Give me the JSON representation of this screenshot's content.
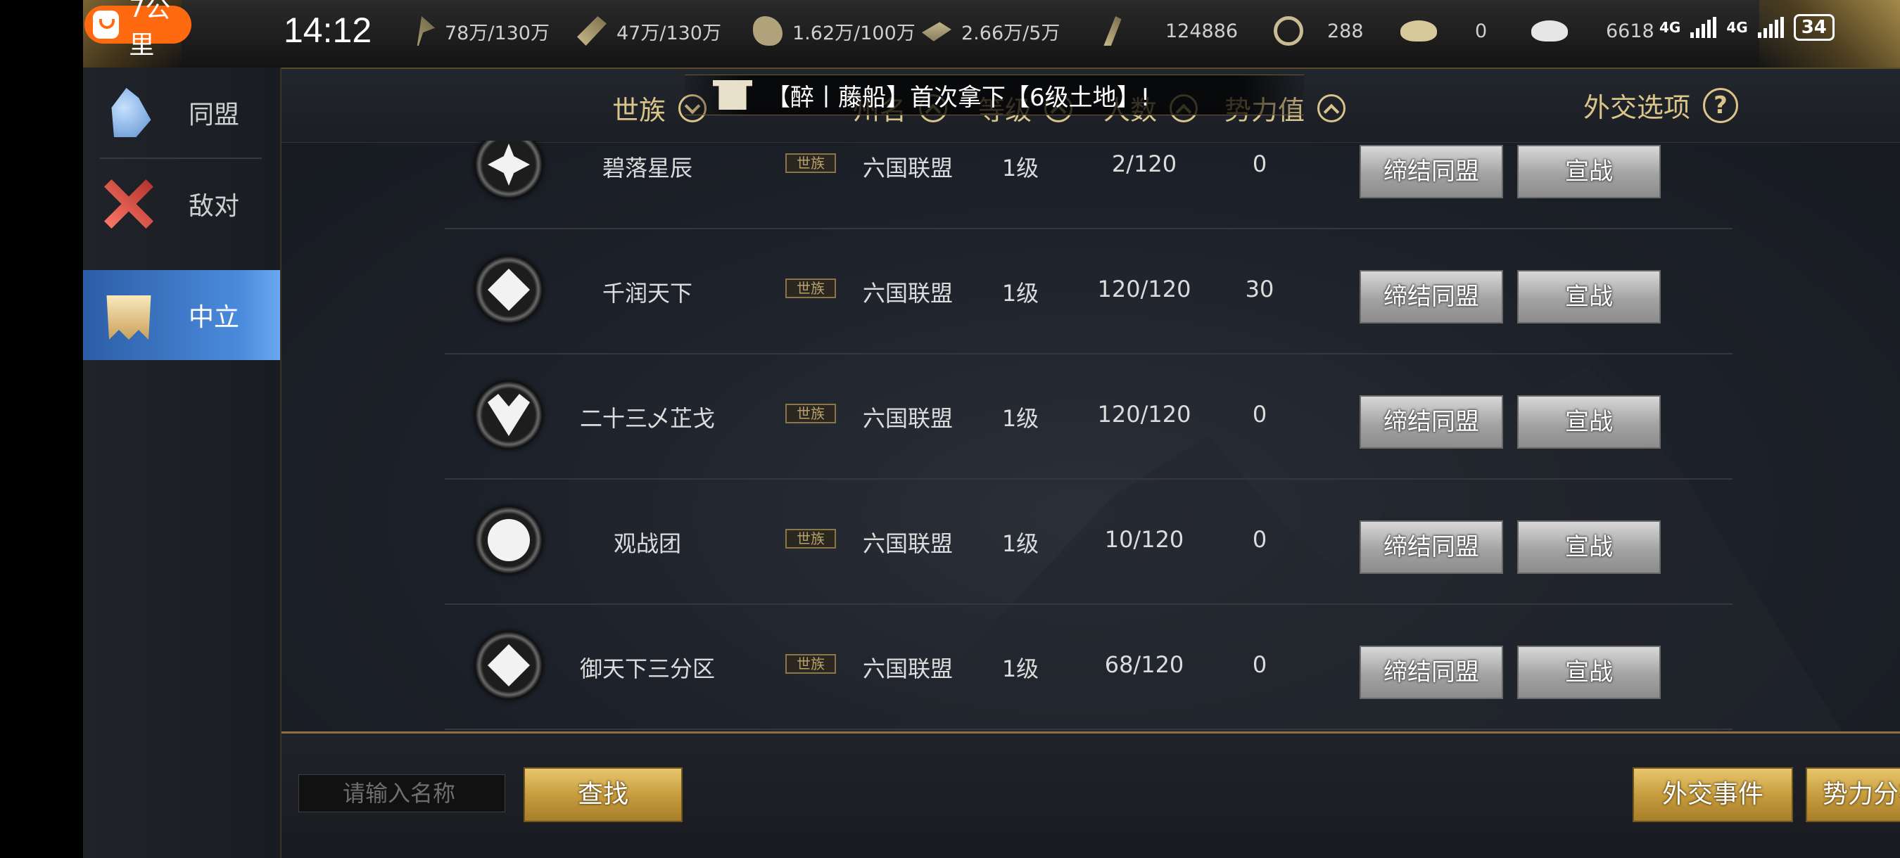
{
  "status": {
    "ride_label": "7公里",
    "clock": "14:12",
    "net1": "4G",
    "net2": "4G",
    "battery": "34"
  },
  "resources": [
    {
      "icon": "grain-icon",
      "value": "78万/130万"
    },
    {
      "icon": "wood-icon",
      "value": "47万/130万"
    },
    {
      "icon": "stone-icon",
      "value": "1.62万/100万"
    },
    {
      "icon": "iron-icon",
      "value": "2.66万/5万"
    },
    {
      "icon": "order-icon",
      "value": "124886"
    },
    {
      "icon": "coin-icon",
      "value": "288"
    },
    {
      "icon": "gold-ingot-icon",
      "value": "0"
    },
    {
      "icon": "silver-ingot-icon",
      "value": "6618"
    }
  ],
  "sidebar": {
    "items": [
      {
        "label": "同盟",
        "icon": "alliance-icon"
      },
      {
        "label": "敌对",
        "icon": "crossed-swords-icon"
      },
      {
        "label": "中立",
        "icon": "banner-icon"
      }
    ],
    "active_index": 2
  },
  "header": {
    "col_clan": "世族",
    "col_state": "州名",
    "col_level": "等级",
    "col_members": "人数",
    "col_power": "势力值",
    "col_diplomacy": "外交选项",
    "help": "?"
  },
  "banner": {
    "text": "【醉丨藤船】首次拿下【6级土地】!"
  },
  "rows": [
    {
      "name": "碧落星辰",
      "tag": "世族",
      "state": "六国联盟",
      "level": "1级",
      "members": "2/120",
      "power": "0",
      "btn_ally": "缔结同盟",
      "btn_war": "宣战"
    },
    {
      "name": "千润天下",
      "tag": "世族",
      "state": "六国联盟",
      "level": "1级",
      "members": "120/120",
      "power": "30",
      "btn_ally": "缔结同盟",
      "btn_war": "宣战"
    },
    {
      "name": "二十三乄芷戈",
      "tag": "世族",
      "state": "六国联盟",
      "level": "1级",
      "members": "120/120",
      "power": "0",
      "btn_ally": "缔结同盟",
      "btn_war": "宣战"
    },
    {
      "name": "观战团",
      "tag": "世族",
      "state": "六国联盟",
      "level": "1级",
      "members": "10/120",
      "power": "0",
      "btn_ally": "缔结同盟",
      "btn_war": "宣战"
    },
    {
      "name": "御天下三分区",
      "tag": "世族",
      "state": "六国联盟",
      "level": "1级",
      "members": "68/120",
      "power": "0",
      "btn_ally": "缔结同盟",
      "btn_war": "宣战"
    }
  ],
  "bottom": {
    "search_placeholder": "请输入名称",
    "search_button": "查找",
    "events_button": "外交事件",
    "map_button": "势力分布图"
  }
}
